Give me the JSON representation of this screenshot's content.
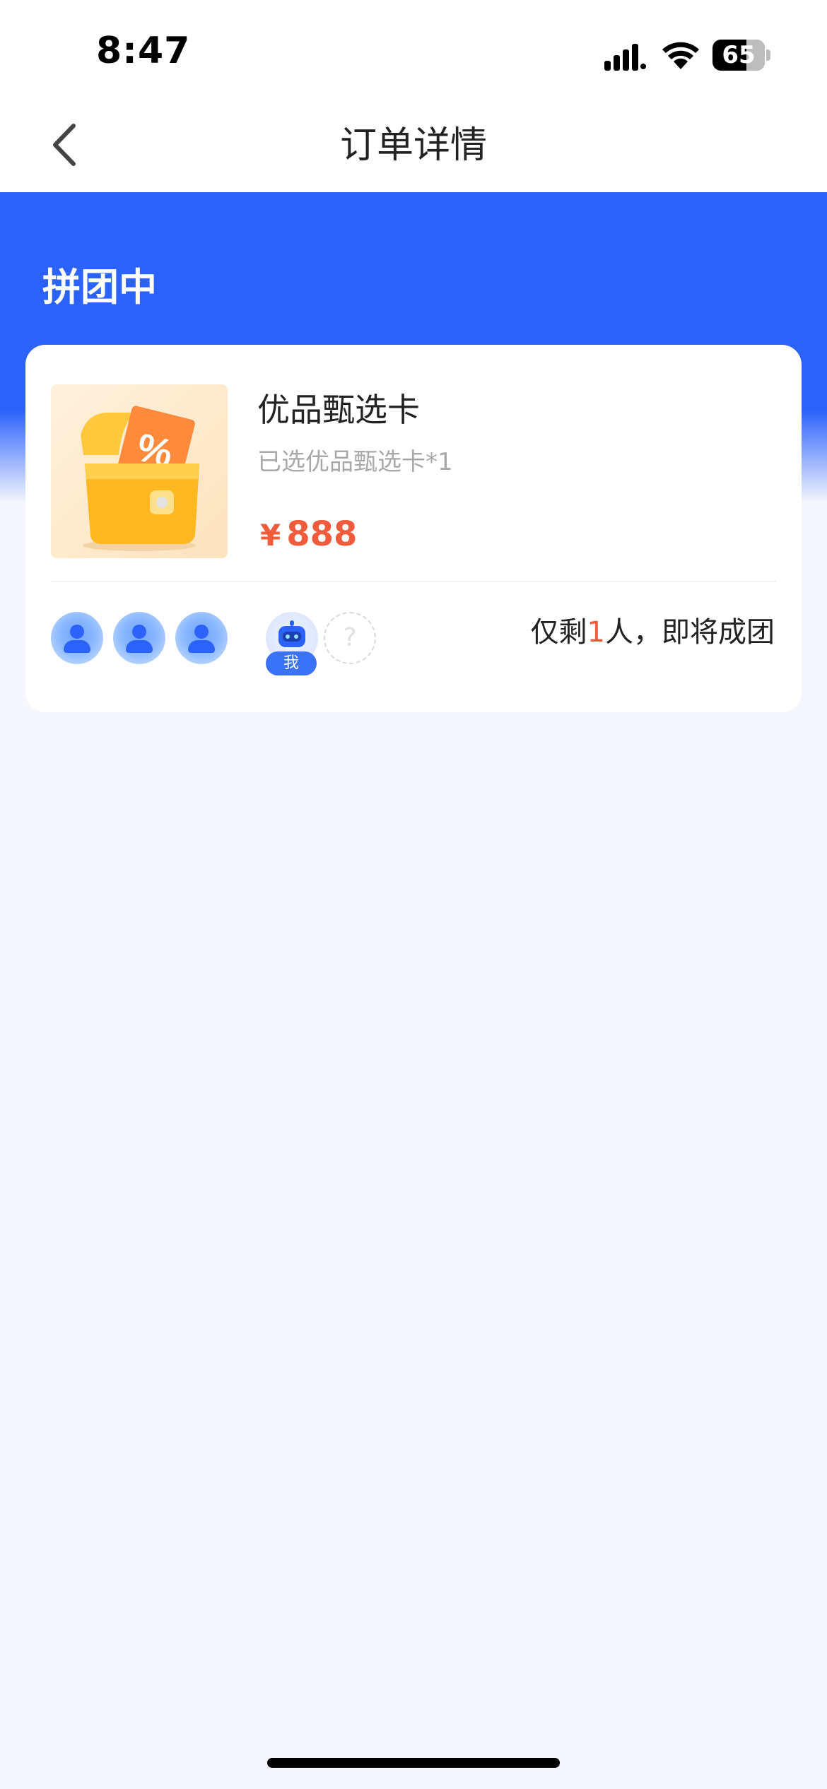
{
  "status_bar": {
    "time": "8:47",
    "battery_level": "65",
    "icons": [
      "cellular-signal-icon",
      "wifi-icon",
      "battery-icon"
    ]
  },
  "nav": {
    "title": "订单详情",
    "back_icon": "chevron-left-icon"
  },
  "order": {
    "status": "拼团中",
    "product": {
      "name": "优品甄选卡",
      "spec": "已选优品甄选卡*1",
      "currency": "¥",
      "price": "888",
      "image_icon": "treasure-box-coupon-icon"
    },
    "group": {
      "members": [
        "member",
        "member",
        "member"
      ],
      "me_label": "我",
      "empty_slot": "?",
      "remain_prefix": "仅剩",
      "remain_count": "1",
      "remain_suffix": "人，即将成团"
    }
  },
  "colors": {
    "primary": "#2B62FA",
    "price": "#EF5B3B",
    "background": "#F5F7FC"
  }
}
